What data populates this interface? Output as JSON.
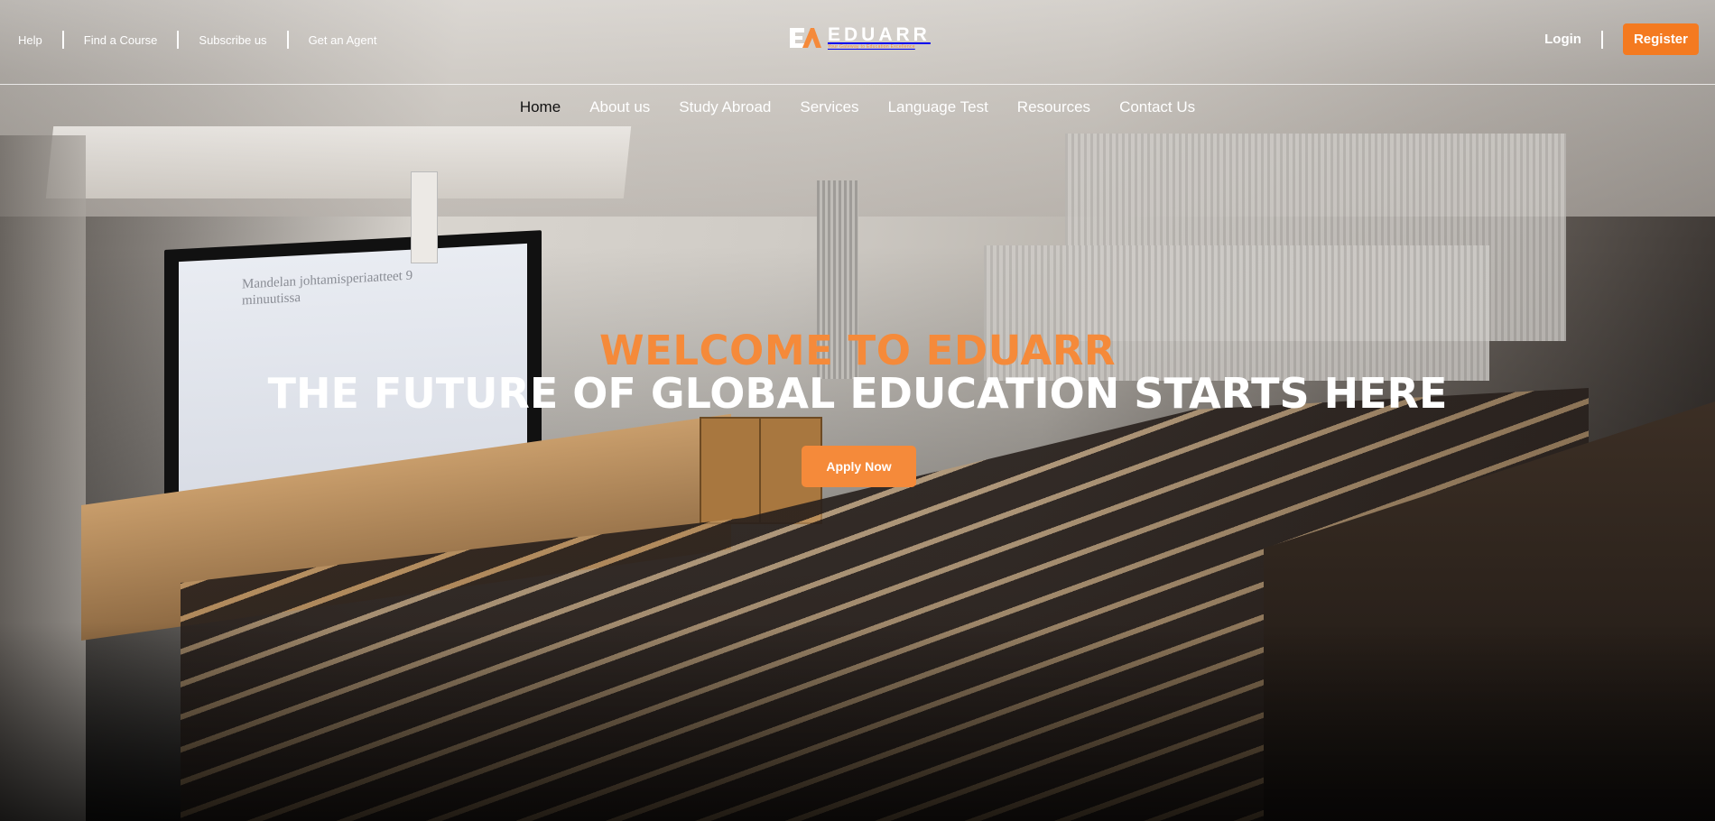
{
  "topbar": {
    "links": [
      "Help",
      "Find a Course",
      "Subscribe us",
      "Get an Agent"
    ],
    "login_label": "Login",
    "register_label": "Register"
  },
  "logo": {
    "name": "EDUARR",
    "tagline": "Your Gateway to Education Excellence"
  },
  "nav": {
    "items": [
      "Home",
      "About us",
      "Study Abroad",
      "Services",
      "Language Test",
      "Resources",
      "Contact Us"
    ],
    "active": "Home"
  },
  "hero": {
    "welcome": "WELCOME TO EDUARR",
    "headline": "THE FUTURE OF GLOBAL EDUCATION STARTS HERE",
    "cta_label": "Apply Now"
  },
  "background": {
    "slide_text": "Mandelan johtamisperiaatteet 9 minuutissa"
  },
  "colors": {
    "accent": "#f58a3a",
    "register_button": "#f47a20",
    "nav_active": "#111111",
    "text": "#ffffff"
  }
}
